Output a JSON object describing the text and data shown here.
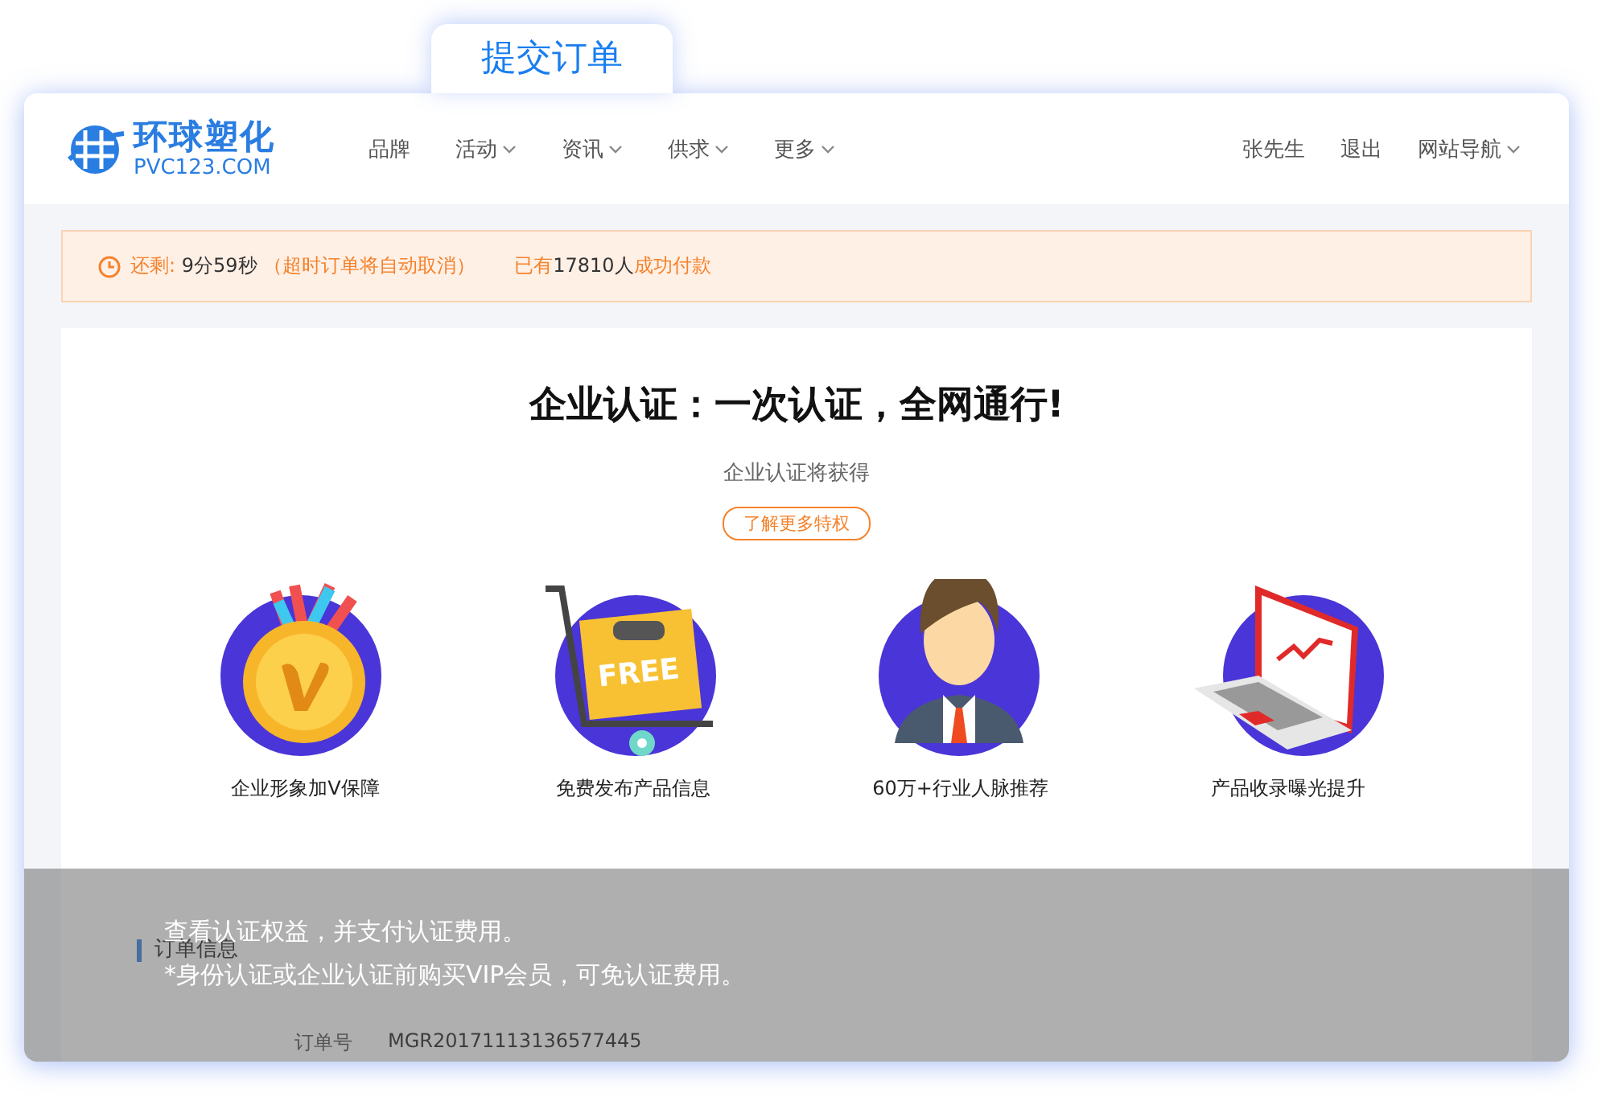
{
  "tab": {
    "label": "提交订单"
  },
  "header": {
    "logo": {
      "name": "环球塑化",
      "domain": "PVC123.COM"
    },
    "nav": [
      {
        "label": "品牌",
        "has_menu": false
      },
      {
        "label": "活动",
        "has_menu": true
      },
      {
        "label": "资讯",
        "has_menu": true
      },
      {
        "label": "供求",
        "has_menu": true
      },
      {
        "label": "更多",
        "has_menu": true
      }
    ],
    "user_links": [
      {
        "label": "张先生",
        "has_menu": false
      },
      {
        "label": "退出",
        "has_menu": false
      },
      {
        "label": "网站导航",
        "has_menu": true
      }
    ]
  },
  "notice": {
    "countdown": [
      {
        "text": "还剩: ",
        "kind": "accent"
      },
      {
        "text": "9分59秒",
        "kind": "plain"
      },
      {
        "text": " （超时订单将自动取消）",
        "kind": "accent"
      }
    ],
    "paid": [
      {
        "text": "已有",
        "kind": "accent"
      },
      {
        "text": "17810人",
        "kind": "plain"
      },
      {
        "text": "成功付款",
        "kind": "accent"
      }
    ]
  },
  "promo": {
    "title": "企业认证：一次认证，全网通行!",
    "subtitle": "企业认证将获得",
    "more_button": "了解更多特权",
    "benefits": [
      {
        "kind": "medal",
        "label": "企业形象加V保障"
      },
      {
        "kind": "cart",
        "label": "免费发布产品信息",
        "badge": "FREE"
      },
      {
        "kind": "person",
        "label": "60万+行业人脉推荐"
      },
      {
        "kind": "laptop",
        "label": "产品收录曝光提升"
      }
    ]
  },
  "order": {
    "title": "订单信息",
    "fields": [
      {
        "label": "订单号",
        "value": "MGR20171113136577445"
      }
    ]
  },
  "caption": {
    "lines": [
      "查看认证权益，并支付认证费用。",
      "*身份认证或企业认证前购买VIP会员，可免认证费用。"
    ]
  }
}
